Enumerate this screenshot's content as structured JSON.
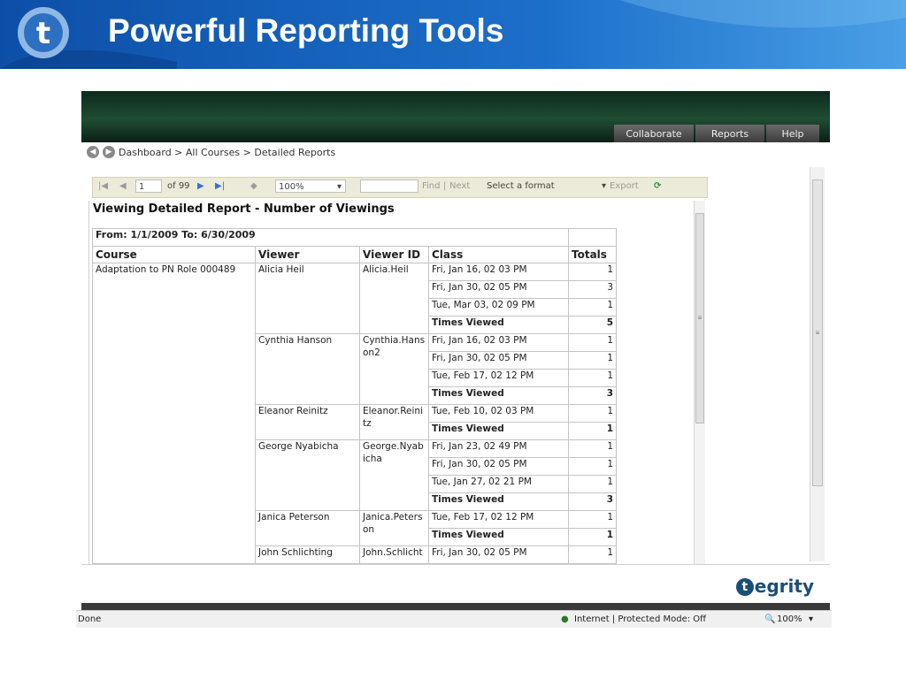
{
  "slide": {
    "title": "Powerful Reporting Tools",
    "logo_letter": "t"
  },
  "app": {
    "nav_tabs": [
      "Collaborate",
      "Reports",
      "Help"
    ],
    "breadcrumb": "Dashboard > All Courses > Detailed Reports",
    "toolbar": {
      "page_current": "1",
      "page_of": "of 99",
      "zoom": "100%",
      "search_value": "",
      "find_label": "Find",
      "separator": "|",
      "next_label": "Next",
      "format_select": "Select a format",
      "export_label": "Export"
    },
    "report": {
      "title": "Viewing Detailed Report - Number of Viewings",
      "date_range": "From: 1/1/2009 To: 6/30/2009",
      "columns": [
        "Course",
        "Viewer",
        "Viewer ID",
        "Class",
        "Totals"
      ],
      "course": "Adaptation to PN Role 000489",
      "times_viewed_label": "Times Viewed",
      "viewers": [
        {
          "name": "Alicia Heil",
          "id": "Alicia.Heil",
          "classes": [
            [
              "Fri, Jan 16, 02 03 PM",
              "1"
            ],
            [
              "Fri, Jan 30, 02 05 PM",
              "3"
            ],
            [
              "Tue, Mar 03, 02 09 PM",
              "1"
            ]
          ],
          "total": "5"
        },
        {
          "name": "Cynthia Hanson",
          "id": "Cynthia.Hanson2",
          "classes": [
            [
              "Fri, Jan 16, 02 03 PM",
              "1"
            ],
            [
              "Fri, Jan 30, 02 05 PM",
              "1"
            ],
            [
              "Tue, Feb 17, 02 12 PM",
              "1"
            ]
          ],
          "total": "3"
        },
        {
          "name": "Eleanor Reinitz",
          "id": "Eleanor.Reinitz",
          "classes": [
            [
              "Tue, Feb 10, 02 03 PM",
              "1"
            ]
          ],
          "total": "1"
        },
        {
          "name": "George Nyabicha",
          "id": "George.Nyabicha",
          "classes": [
            [
              "Fri, Jan 23, 02 49 PM",
              "1"
            ],
            [
              "Fri, Jan 30, 02 05 PM",
              "1"
            ],
            [
              "Tue, Jan 27, 02 21 PM",
              "1"
            ]
          ],
          "total": "3"
        },
        {
          "name": "Janica Peterson",
          "id": "Janica.Peterson",
          "classes": [
            [
              "Tue, Feb 17, 02 12 PM",
              "1"
            ]
          ],
          "total": "1"
        },
        {
          "name": "John Schlichting",
          "id": "John.Schlicht",
          "classes": [
            [
              "Fri, Jan 30, 02 05 PM",
              "1"
            ]
          ],
          "total": null
        }
      ]
    },
    "brand": {
      "logo_letter": "t",
      "text": "egrity"
    },
    "status": {
      "left": "Done",
      "zone": "Internet | Protected Mode: Off",
      "zoom": "100%"
    }
  },
  "colors": {
    "banner": "#1c6fc9",
    "title_text": "#ffffff",
    "header_green": "#1f4d33",
    "brand_blue": "#1a4e7a"
  },
  "icons": [
    "back-icon",
    "forward-icon",
    "first-page-icon",
    "prev-page-icon",
    "next-page-icon",
    "last-page-icon",
    "back-to-parent-icon",
    "dropdown-icon",
    "refresh-icon",
    "globe-icon",
    "magnifier-icon"
  ]
}
